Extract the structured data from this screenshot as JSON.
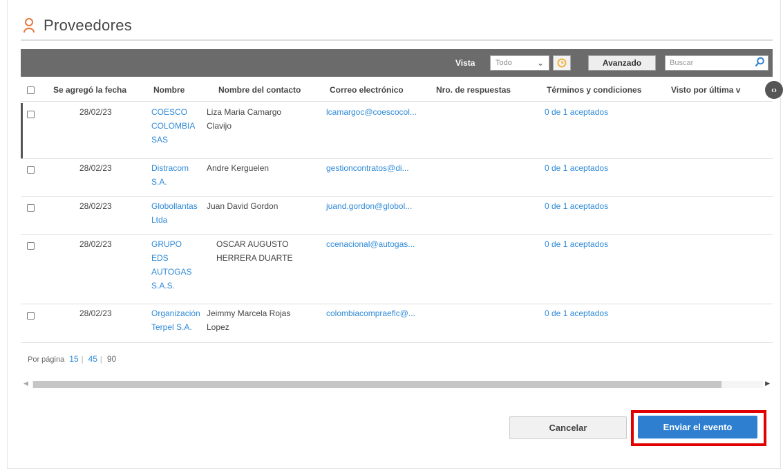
{
  "page": {
    "title": "Proveedores"
  },
  "toolbar": {
    "vista_label": "Vista",
    "vista_value": "Todo",
    "advanced_label": "Avanzado",
    "search_placeholder": "Buscar"
  },
  "table": {
    "columns": [
      "Se agregó la fecha",
      "Nombre",
      "Nombre del contacto",
      "Correo electrónico",
      "Nro. de respuestas",
      "Términos y condiciones",
      "Visto por última v"
    ],
    "rows": [
      {
        "date": "28/02/23",
        "name": [
          "COESCO",
          "COLOMBIA",
          "SAS"
        ],
        "contact": [
          "Liza Maria Camargo",
          "Clavijo"
        ],
        "email": "lcamargoc@coescocol...",
        "terms": "0 de 1 aceptados"
      },
      {
        "date": "28/02/23",
        "name": [
          "Distracom",
          "S.A."
        ],
        "contact": [
          "Andre Kerguelen"
        ],
        "email": "gestioncontratos@di...",
        "terms": "0 de 1 aceptados"
      },
      {
        "date": "28/02/23",
        "name": [
          "Globollantas",
          "Ltda"
        ],
        "contact": [
          "Juan David Gordon"
        ],
        "email": "juand.gordon@globol...",
        "terms": "0 de 1 aceptados"
      },
      {
        "date": "28/02/23",
        "name": [
          "GRUPO",
          "EDS",
          "AUTOGAS",
          "S.A.S."
        ],
        "contact": [
          "OSCAR AUGUSTO",
          "HERRERA DUARTE"
        ],
        "email": "ccenacional@autogas...",
        "terms": "0 de 1 aceptados"
      },
      {
        "date": "28/02/23",
        "name": [
          "Organización",
          "Terpel S.A."
        ],
        "contact": [
          "Jeimmy Marcela Rojas",
          "Lopez"
        ],
        "email": "colombiacompraeflc@...",
        "terms": "0 de 1 aceptados"
      }
    ]
  },
  "pager": {
    "label": "Por página",
    "options": [
      "15",
      "45",
      "90"
    ]
  },
  "footer": {
    "cancel_label": "Cancelar",
    "send_label": "Enviar el evento"
  },
  "colors": {
    "link": "#2f8ad8",
    "primary": "#2f7fd0",
    "highlight": "#e00000",
    "toolbar": "#6b6b6b"
  }
}
